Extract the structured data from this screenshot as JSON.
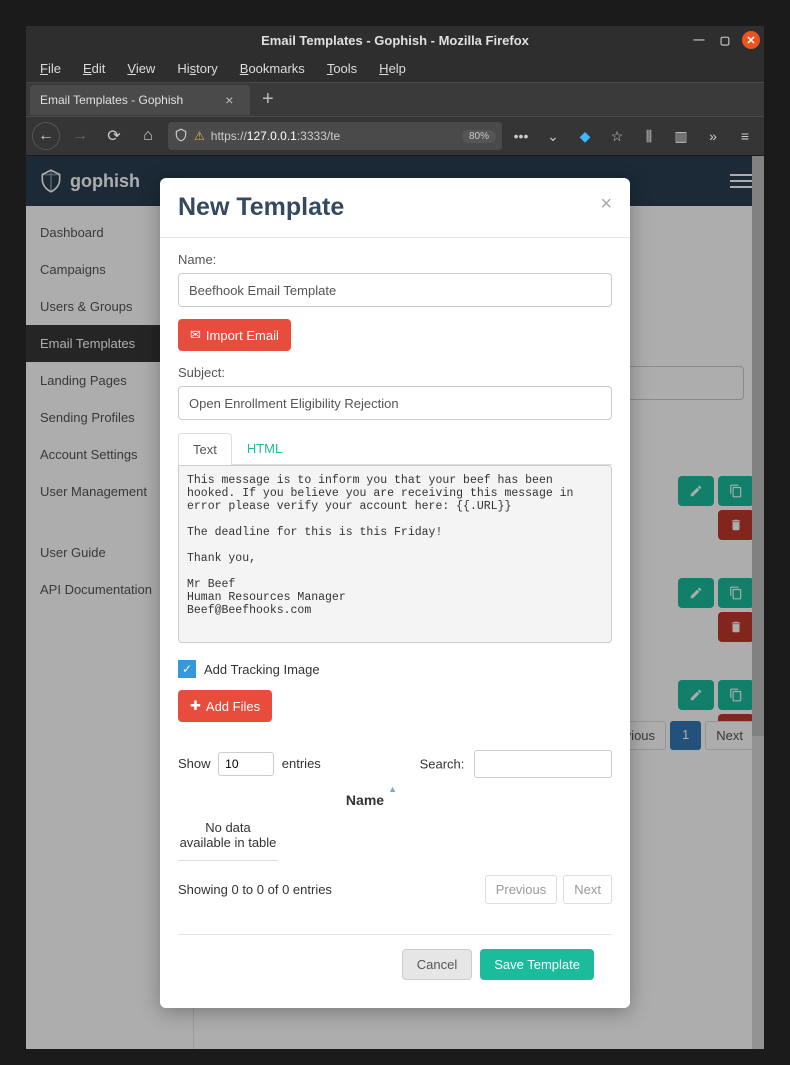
{
  "window": {
    "title": "Email Templates - Gophish - Mozilla Firefox"
  },
  "menubar": {
    "file": "File",
    "edit": "Edit",
    "view": "View",
    "history": "History",
    "bookmarks": "Bookmarks",
    "tools": "Tools",
    "help": "Help"
  },
  "tab": {
    "title": "Email Templates - Gophish"
  },
  "urlbar": {
    "prefix": "https://",
    "host": "127.0.0.1",
    "suffix": ":3333/te",
    "zoom": "80%"
  },
  "brand": "gophish",
  "sidebar": {
    "items": [
      {
        "label": "Dashboard"
      },
      {
        "label": "Campaigns"
      },
      {
        "label": "Users & Groups"
      },
      {
        "label": "Email Templates",
        "active": true
      },
      {
        "label": "Landing Pages"
      },
      {
        "label": "Sending Profiles"
      },
      {
        "label": "Account Settings"
      },
      {
        "label": "User Management"
      }
    ],
    "secondary": [
      {
        "label": "User Guide"
      },
      {
        "label": "API Documentation"
      }
    ]
  },
  "bg_pagination": {
    "prev": "evious",
    "current": "1",
    "next": "Next"
  },
  "modal": {
    "title": "New Template",
    "name_label": "Name:",
    "name_value": "Beefhook Email Template",
    "import_email": "Import Email",
    "subject_label": "Subject:",
    "subject_value": "Open Enrollment Eligibility Rejection",
    "tab_text": "Text",
    "tab_html": "HTML",
    "body": "This message is to inform you that your beef has been hooked. If you believe you are receiving this message in error please verify your account here: {{.URL}}\n\nThe deadline for this is this Friday!\n\nThank you,\n\nMr Beef\nHuman Resources Manager\nBeef@Beefhooks.com",
    "tracking_label": "Add Tracking Image",
    "tracking_checked": true,
    "add_files": "Add Files",
    "dt": {
      "show": "Show",
      "entries": "entries",
      "length_value": "10",
      "search_label": "Search:",
      "col_name": "Name",
      "empty": "No data available in table",
      "info": "Showing 0 to 0 of 0 entries",
      "prev": "Previous",
      "next": "Next"
    },
    "cancel": "Cancel",
    "save": "Save Template"
  }
}
